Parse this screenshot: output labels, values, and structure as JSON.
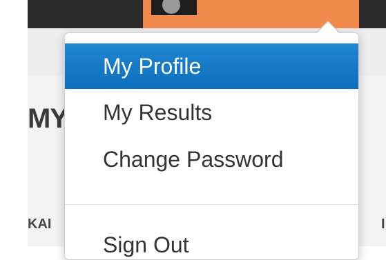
{
  "colors": {
    "topbar": "#2b2b2b",
    "topbar_active": "#f28a4d",
    "menu_highlight": "#1578c7",
    "menu_text": "#333333"
  },
  "background": {
    "heading_fragment": "MY",
    "left_column_fragment": "KAI",
    "right_column_fragment": "I"
  },
  "menu": {
    "items": [
      {
        "label": "My Profile",
        "active": true
      },
      {
        "label": "My Results",
        "active": false
      },
      {
        "label": "Change Password",
        "active": false
      },
      {
        "label": "Sign Out",
        "active": false
      }
    ]
  }
}
